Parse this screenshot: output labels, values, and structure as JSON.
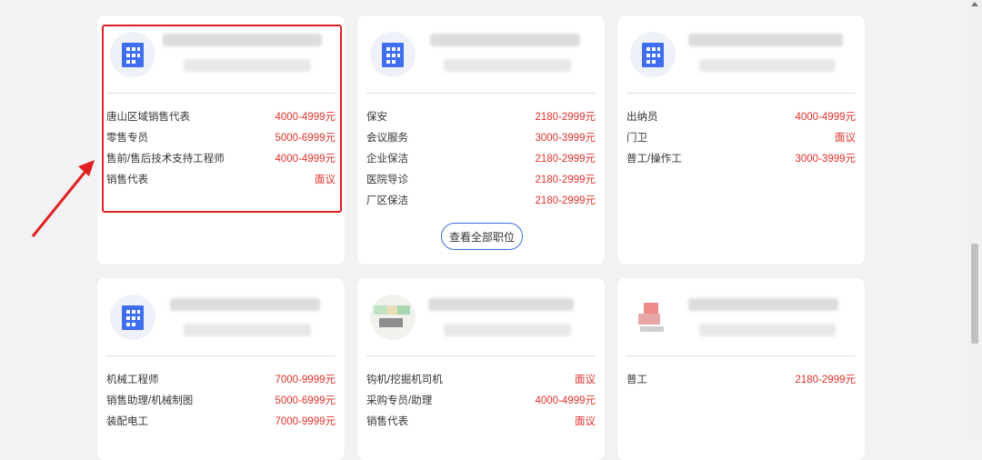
{
  "colors": {
    "salary": "#e0312b",
    "accent_blue": "#3c6fd6",
    "annotation_red": "#e02020"
  },
  "cards": [
    {
      "logo": "building-icon",
      "jobs": [
        {
          "title": "唐山区域销售代表",
          "salary": "4000-4999元"
        },
        {
          "title": "零售专员",
          "salary": "5000-6999元"
        },
        {
          "title": "售前/售后技术支持工程师",
          "salary": "4000-4999元"
        },
        {
          "title": "销售代表",
          "salary": "面议"
        }
      ]
    },
    {
      "logo": "building-icon",
      "jobs": [
        {
          "title": "保安",
          "salary": "2180-2999元"
        },
        {
          "title": "会议服务",
          "salary": "3000-3999元"
        },
        {
          "title": "企业保洁",
          "salary": "2180-2999元"
        },
        {
          "title": "医院导诊",
          "salary": "2180-2999元"
        },
        {
          "title": "厂区保洁",
          "salary": "2180-2999元"
        }
      ],
      "view_all": "查看全部职位"
    },
    {
      "logo": "building-icon",
      "jobs": [
        {
          "title": "出纳员",
          "salary": "4000-4999元"
        },
        {
          "title": "门卫",
          "salary": "面议"
        },
        {
          "title": "普工/操作工",
          "salary": "3000-3999元"
        }
      ]
    },
    {
      "logo": "building-icon",
      "jobs": [
        {
          "title": "机械工程师",
          "salary": "7000-9999元"
        },
        {
          "title": "销售助理/机械制图",
          "salary": "5000-6999元"
        },
        {
          "title": "装配电工",
          "salary": "7000-9999元"
        }
      ]
    },
    {
      "logo": "company-logo",
      "jobs": [
        {
          "title": "钩机/挖掘机司机",
          "salary": "面议"
        },
        {
          "title": "采购专员/助理",
          "salary": "4000-4999元"
        },
        {
          "title": "销售代表",
          "salary": "面议"
        }
      ]
    },
    {
      "logo": "company-logo",
      "jobs": [
        {
          "title": "普工",
          "salary": "2180-2999元"
        }
      ]
    }
  ]
}
